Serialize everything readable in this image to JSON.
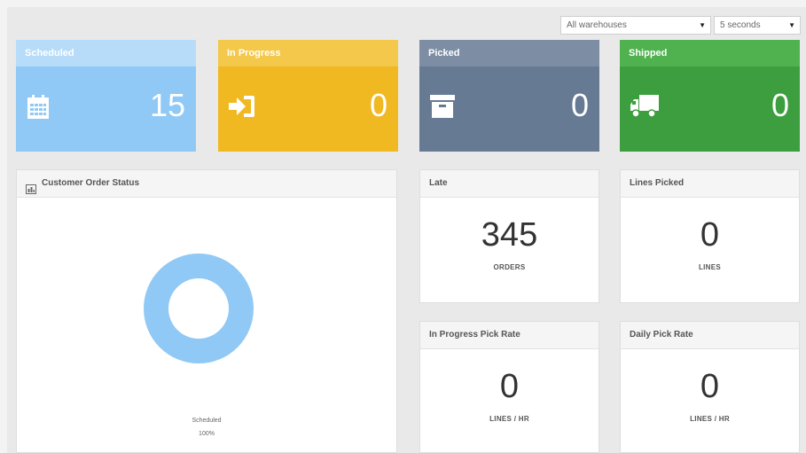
{
  "filters": {
    "warehouse": "All warehouses",
    "refresh": "5 seconds"
  },
  "tiles": [
    {
      "label": "Scheduled",
      "value": "15",
      "icon": "calendar-icon",
      "color": "#90c9f5"
    },
    {
      "label": "In Progress",
      "value": "0",
      "icon": "sign-in-icon",
      "color": "#f0b922"
    },
    {
      "label": "Picked",
      "value": "0",
      "icon": "archive-box-icon",
      "color": "#667a94"
    },
    {
      "label": "Shipped",
      "value": "0",
      "icon": "truck-icon",
      "color": "#3d9e3f"
    }
  ],
  "customer_order_status": {
    "title": "Customer Order Status",
    "icon": "bar-chart-icon",
    "chart_data": {
      "type": "pie",
      "categories": [
        "Scheduled"
      ],
      "values": [
        100
      ],
      "colors": [
        "#90c9f5"
      ],
      "donut": true,
      "labels": [
        {
          "name": "Scheduled",
          "percent": "100%"
        }
      ]
    }
  },
  "metrics": {
    "late": {
      "title": "Late",
      "value": "345",
      "unit": "ORDERS"
    },
    "lines_picked": {
      "title": "Lines Picked",
      "value": "0",
      "unit": "LINES"
    },
    "in_progress_pick_rate": {
      "title": "In Progress Pick Rate",
      "value": "0",
      "unit": "LINES / HR"
    },
    "daily_pick_rate": {
      "title": "Daily Pick Rate",
      "value": "0",
      "unit": "LINES / HR"
    }
  }
}
